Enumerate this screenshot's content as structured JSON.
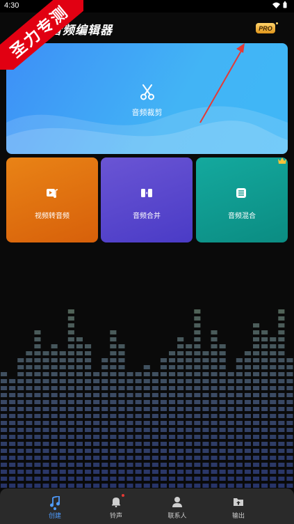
{
  "status_bar": {
    "time": "4:30"
  },
  "app": {
    "title": "音频编辑器",
    "pro_badge": "PRO"
  },
  "watermark": {
    "text": "圣力专测"
  },
  "cards": {
    "main": {
      "label": "音频裁剪",
      "icon": "scissors-icon"
    },
    "video_to_audio": {
      "label": "视频转音频",
      "icon": "video-music-icon"
    },
    "merge": {
      "label": "音频合并",
      "icon": "merge-icon"
    },
    "mix": {
      "label": "音频混合",
      "icon": "mix-icon",
      "premium": "crown-icon"
    }
  },
  "nav": {
    "items": [
      {
        "label": "创建",
        "icon": "music-note-icon",
        "active": true
      },
      {
        "label": "铃声",
        "icon": "bell-icon",
        "badge": true
      },
      {
        "label": "联系人",
        "icon": "contact-icon"
      },
      {
        "label": "输出",
        "icon": "folder-export-icon"
      }
    ]
  },
  "colors": {
    "main_card": "#42a6f6",
    "video_card": "#e0720f",
    "merge_card": "#5a48cf",
    "mix_card": "#10a095",
    "accent": "#4f9cff",
    "watermark": "#e10012",
    "annotation_arrow": "#e53935"
  }
}
